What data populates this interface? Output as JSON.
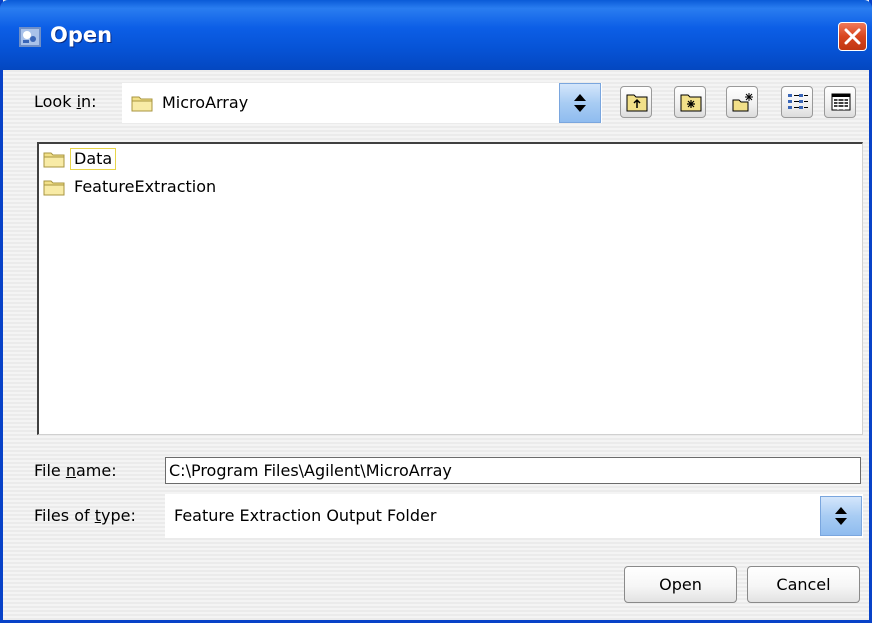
{
  "window": {
    "title": "Open",
    "close_icon": "close-icon"
  },
  "look_in": {
    "label": "Look in:",
    "label_mnemonic_prefix": "Look ",
    "label_mnemonic_char": "i",
    "label_mnemonic_suffix": "n:",
    "value": "MicroArray",
    "icon": "folder-icon"
  },
  "toolbar": {
    "buttons": [
      {
        "name": "up-one-level-button",
        "icon": "folder-up-icon"
      },
      {
        "name": "home-button",
        "icon": "home-folder-icon"
      },
      {
        "name": "new-folder-button",
        "icon": "new-folder-icon"
      },
      {
        "name": "list-view-button",
        "icon": "list-view-icon"
      },
      {
        "name": "details-view-button",
        "icon": "details-view-icon"
      }
    ]
  },
  "files": [
    {
      "name": "Data",
      "type": "folder",
      "focused": true
    },
    {
      "name": "FeatureExtraction",
      "type": "folder",
      "focused": false
    }
  ],
  "file_name": {
    "label_prefix": "File ",
    "label_mnemonic_char": "n",
    "label_suffix": "ame:",
    "value": "C:\\Program Files\\Agilent\\MicroArray"
  },
  "file_type": {
    "label_prefix": "Files of ",
    "label_mnemonic_char": "t",
    "label_suffix": "ype:",
    "value": "Feature Extraction Output Folder"
  },
  "buttons": {
    "open_label": "Open",
    "cancel_label": "Cancel"
  },
  "colors": {
    "titlebar": "#0653d6",
    "close": "#d8451e",
    "folder": "#f2e089"
  }
}
